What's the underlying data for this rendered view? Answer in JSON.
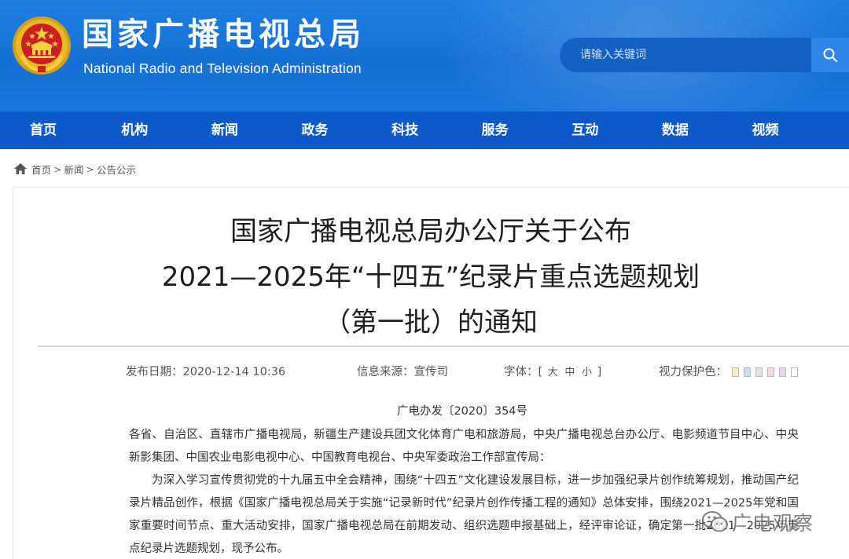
{
  "header": {
    "title_cn": "国家广播电视总局",
    "title_en": "National Radio and Television Administration",
    "emblem_icon": "national-emblem-icon",
    "search": {
      "placeholder": "请输入关键词",
      "button_icon": "search-icon"
    },
    "colors": {
      "header_blue": "#1670d6",
      "nav_blue": "#0c5ac9"
    }
  },
  "nav": {
    "items": [
      "首页",
      "机构",
      "新闻",
      "政务",
      "科技",
      "服务",
      "互动",
      "数据",
      "视频"
    ]
  },
  "breadcrumb": {
    "home_icon": "home-icon",
    "items": [
      "首页",
      "新闻",
      "公告公示"
    ],
    "separator": ">"
  },
  "article": {
    "title_lines": [
      "国家广播电视总局办公厅关于公布",
      "2021—2025年“十四五”纪录片重点选题规划",
      "（第一批）的通知"
    ],
    "meta": {
      "date": "发布日期：2020-12-14 10:36",
      "source": "信息来源：宣传司",
      "font_label": "字体：[",
      "font_large": "大",
      "font_medium": "中",
      "font_small": "小",
      "font_close": "]",
      "eye_label": "视力保护色：",
      "eye_colors": [
        "#f7efb6",
        "#c9dff3",
        "#e2e2e2",
        "#f4d9de",
        "#e3d7f2",
        "#ffffff"
      ]
    },
    "doc_number": "广电办发〔2020〕354号",
    "paragraphs": [
      "各省、自治区、直辖市广播电视局，新疆生产建设兵团文化体育广电和旅游局，中央广播电视总台办公厅、电影频道节目中心、中央新影集团、中国农业电影电视中心、中国教育电视台、中央军委政治工作部宣传局：",
      "为深入学习宣传贯彻党的十九届五中全会精神，围绕“十四五”文化建设发展目标，进一步加强纪录片创作统筹规划，推动国产纪录片精品创作，根据《国家广播电视总局关于实施“记录新时代”纪录片创作传播工程的通知》总体安排，围绕2021—2025年党和国家重要时间节点、重大活动安排，国家广播电视总局在前期发动、组织选题申报基础上，经评审论证，确定第一批2021—2025年重点纪录片选题规划，现予公布。"
    ]
  },
  "watermark": {
    "icon": "wechat-icon",
    "text": "广电观察"
  }
}
